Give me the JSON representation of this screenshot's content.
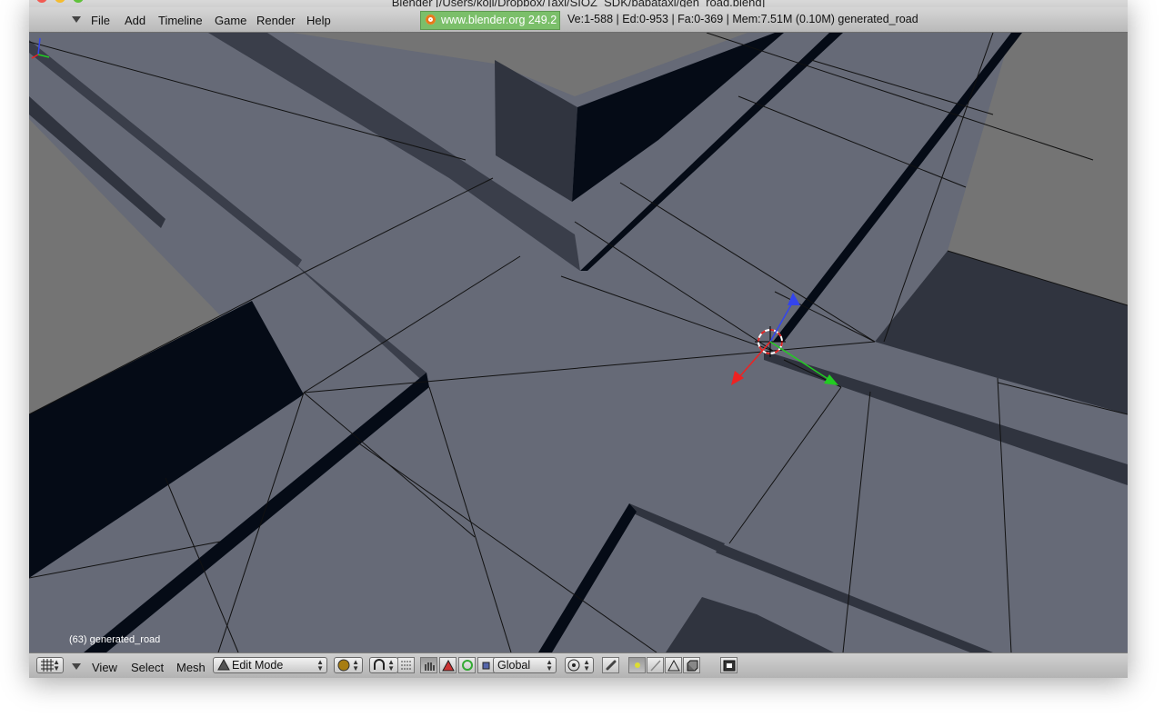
{
  "window": {
    "title": "Blender [/Users/koji/Dropbox/Taxi/SIOZ_SDK/babataxi/gen_road.blend]"
  },
  "menu": {
    "items": [
      "File",
      "Add",
      "Timeline",
      "Game",
      "Render",
      "Help"
    ]
  },
  "info": {
    "url": "www.blender.org 249.2",
    "stats": "Ve:1-588 | Ed:0-953 | Fa:0-369 | Mem:7.51M (0.10M) generated_road"
  },
  "viewport": {
    "object_label": "(63) generated_road"
  },
  "toolbar": {
    "view": "View",
    "select": "Select",
    "mesh": "Mesh",
    "mode": "Edit Mode",
    "orientation": "Global"
  },
  "colors": {
    "viewport_bg": "#666a77",
    "grey_ground": "#747474",
    "dark_face": "#30343f",
    "black_face": "#050b16",
    "info_green": "#7bbf6a"
  },
  "icons": [
    "view-type-icon",
    "menu-arrow-icon",
    "shading-solid-icon",
    "magnet-icon",
    "snap-icon",
    "hand-icon",
    "translate-icon",
    "rotate-icon",
    "scale-icon",
    "pivot-icon",
    "link-icon",
    "vertex-select-icon",
    "edge-select-icon",
    "face-select-icon",
    "occlude-icon",
    "render-icon"
  ]
}
